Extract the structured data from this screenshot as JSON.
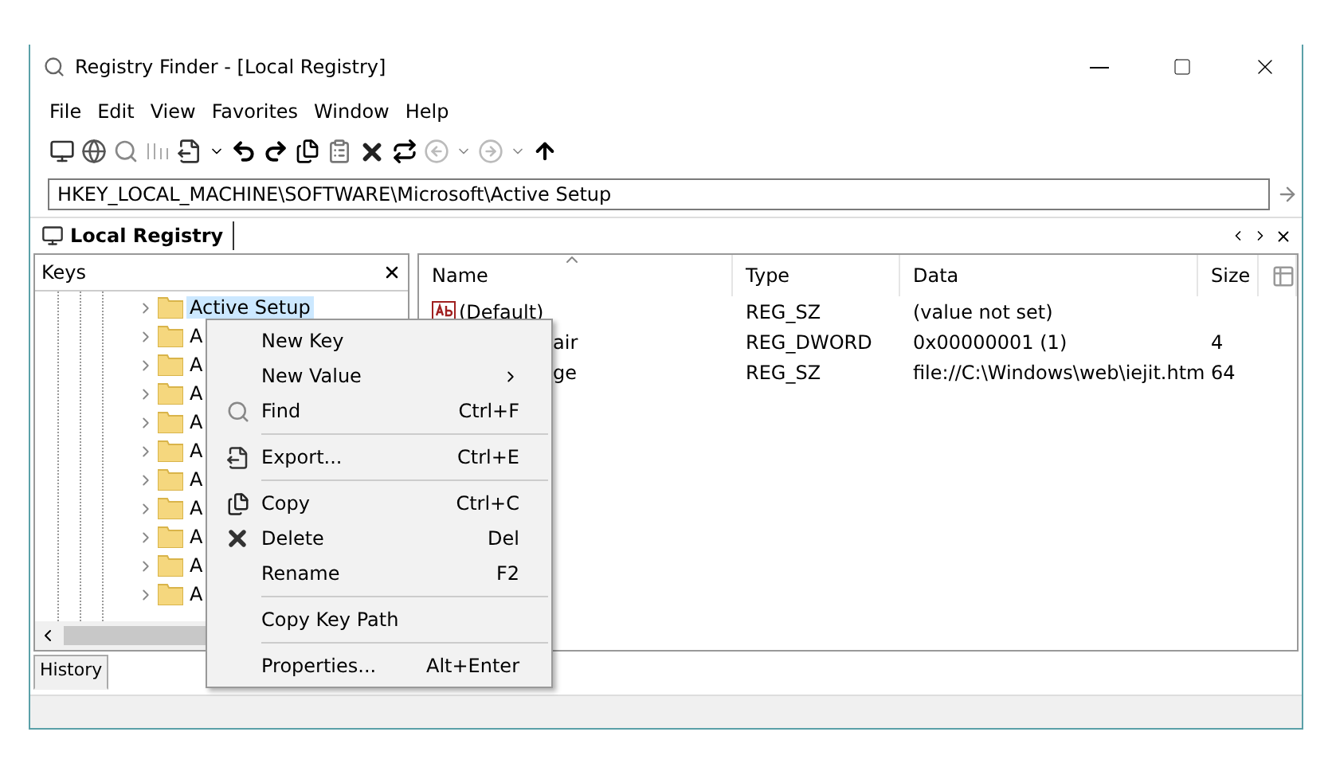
{
  "window": {
    "title": "Registry Finder - [Local Registry]"
  },
  "menu": [
    "File",
    "Edit",
    "View",
    "Favorites",
    "Window",
    "Help"
  ],
  "address": {
    "value": "HKEY_LOCAL_MACHINE\\SOFTWARE\\Microsoft\\Active Setup"
  },
  "tabs": [
    {
      "label": "Local Registry",
      "selected": true
    }
  ],
  "keys_pane": {
    "title": "Keys",
    "items": [
      {
        "label": "Active Setup",
        "selected": true
      },
      {
        "label": "A",
        "selected": false
      },
      {
        "label": "A",
        "selected": false
      },
      {
        "label": "A",
        "selected": false
      },
      {
        "label": "A",
        "selected": false
      },
      {
        "label": "A",
        "selected": false
      },
      {
        "label": "A",
        "selected": false
      },
      {
        "label": "A",
        "selected": false
      },
      {
        "label": "A",
        "selected": false
      },
      {
        "label": "A",
        "selected": false
      },
      {
        "label": "A",
        "selected": false
      }
    ]
  },
  "values_table": {
    "columns": [
      "Name",
      "Type",
      "Data",
      "Size"
    ],
    "rows": [
      {
        "name": "(Default)",
        "kind": "string",
        "type": "REG_SZ",
        "data": "(value not set)"
      },
      {
        "name": "air",
        "kind": "hidden",
        "type": "REG_DWORD",
        "data": "0x00000001 (1)",
        "size": "4"
      },
      {
        "name": "ge",
        "kind": "hidden",
        "type": "REG_SZ",
        "data": "file://C:\\Windows\\web\\iejit.htm",
        "size": "64"
      }
    ]
  },
  "bottom_tabs": [
    {
      "label": "History",
      "selected": true
    }
  ],
  "context_menu": [
    {
      "kind": "item",
      "label": "New Key"
    },
    {
      "kind": "submenu",
      "label": "New Value"
    },
    {
      "kind": "find",
      "label": "Find",
      "shortcut": "Ctrl+F"
    },
    {
      "kind": "separator"
    },
    {
      "kind": "export",
      "label": "Export...",
      "shortcut": "Ctrl+E"
    },
    {
      "kind": "separator"
    },
    {
      "kind": "copy",
      "label": "Copy",
      "shortcut": "Ctrl+C"
    },
    {
      "kind": "delete",
      "label": "Delete",
      "shortcut": "Del"
    },
    {
      "kind": "item",
      "label": "Rename",
      "shortcut": "F2"
    },
    {
      "kind": "separator"
    },
    {
      "kind": "item",
      "label": "Copy Key Path"
    },
    {
      "kind": "separator"
    },
    {
      "kind": "item",
      "label": "Properties...",
      "shortcut": "Alt+Enter"
    }
  ]
}
